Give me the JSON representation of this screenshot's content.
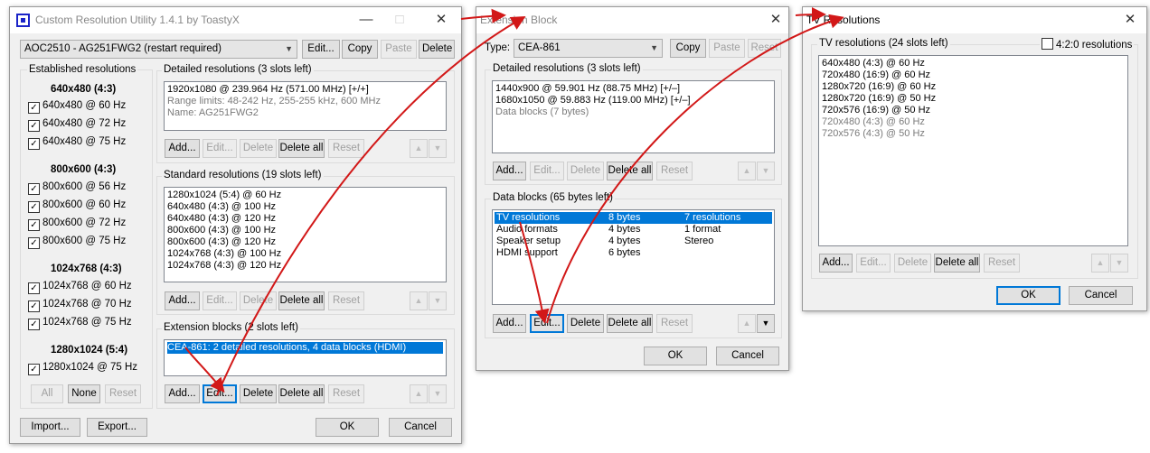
{
  "win1": {
    "title": "Custom Resolution Utility 1.4.1 by ToastyX",
    "monitor": "AOC2510 - AG251FWG2 (restart required)",
    "top_buttons": [
      "Edit...",
      "Copy",
      "Paste",
      "Delete"
    ],
    "established": {
      "label": "Established resolutions",
      "groups": [
        {
          "heading": "640x480 (4:3)",
          "items": [
            "640x480 @ 60 Hz",
            "640x480 @ 72 Hz",
            "640x480 @ 75 Hz"
          ]
        },
        {
          "heading": "800x600 (4:3)",
          "items": [
            "800x600 @ 56 Hz",
            "800x600 @ 60 Hz",
            "800x600 @ 72 Hz",
            "800x600 @ 75 Hz"
          ]
        },
        {
          "heading": "1024x768 (4:3)",
          "items": [
            "1024x768 @ 60 Hz",
            "1024x768 @ 70 Hz",
            "1024x768 @ 75 Hz"
          ]
        },
        {
          "heading": "1280x1024 (5:4)",
          "items": [
            "1280x1024 @ 75 Hz"
          ]
        }
      ],
      "buttons": [
        "All",
        "None",
        "Reset"
      ]
    },
    "detailed": {
      "label": "Detailed resolutions (3 slots left)",
      "line1": "1920x1080 @ 239.964 Hz (571.00 MHz) [+/+]",
      "line2": "Range limits: 48-242 Hz, 255-255 kHz, 600 MHz",
      "line3": "Name: AG251FWG2"
    },
    "standard": {
      "label": "Standard resolutions (19 slots left)",
      "items": [
        "1280x1024 (5:4) @ 60 Hz",
        "640x480 (4:3) @ 100 Hz",
        "640x480 (4:3) @ 120 Hz",
        "800x600 (4:3) @ 100 Hz",
        "800x600 (4:3) @ 120 Hz",
        "1024x768 (4:3) @ 100 Hz",
        "1024x768 (4:3) @ 120 Hz"
      ]
    },
    "extension": {
      "label": "Extension blocks (2 slots left)",
      "item": "CEA-861: 2 detailed resolutions, 4 data blocks (HDMI)"
    },
    "list_buttons": [
      "Add...",
      "Edit...",
      "Delete",
      "Delete all",
      "Reset"
    ],
    "bottom": [
      "Import...",
      "Export...",
      "OK",
      "Cancel"
    ]
  },
  "win2": {
    "title": "Extension Block",
    "type_label": "Type:",
    "type_value": "CEA-861",
    "top_buttons": [
      "Copy",
      "Paste",
      "Reset"
    ],
    "detailed": {
      "label": "Detailed resolutions (3 slots left)",
      "line1": "1440x900 @ 59.901 Hz (88.75 MHz) [+/–]",
      "line2": "1680x1050 @ 59.883 Hz (119.00 MHz) [+/–]",
      "line3": "Data blocks (7 bytes)"
    },
    "data_blocks": {
      "label": "Data blocks (65 bytes left)",
      "rows": [
        {
          "name": "TV resolutions",
          "size": "8 bytes",
          "info": "7 resolutions"
        },
        {
          "name": "Audio formats",
          "size": "4 bytes",
          "info": "1 format"
        },
        {
          "name": "Speaker setup",
          "size": "4 bytes",
          "info": "Stereo"
        },
        {
          "name": "HDMI support",
          "size": "6 bytes",
          "info": ""
        }
      ]
    },
    "list_buttons": [
      "Add...",
      "Edit...",
      "Delete",
      "Delete all",
      "Reset"
    ],
    "bottom": [
      "OK",
      "Cancel"
    ]
  },
  "win3": {
    "title": "TV Resolutions",
    "label": "TV resolutions (24 slots left)",
    "checkbox": "4:2:0 resolutions",
    "items": [
      "640x480 (4:3) @ 60 Hz",
      "720x480 (16:9) @ 60 Hz",
      "1280x720 (16:9) @ 60 Hz",
      "1280x720 (16:9) @ 50 Hz",
      "720x576 (16:9) @ 50 Hz"
    ],
    "gray_items": [
      "720x480 (4:3) @ 60 Hz",
      "720x576 (4:3) @ 50 Hz"
    ],
    "list_buttons": [
      "Add...",
      "Edit...",
      "Delete",
      "Delete all",
      "Reset"
    ],
    "bottom": [
      "OK",
      "Cancel"
    ]
  },
  "colors": {
    "selection": "#0078d7",
    "arrow": "#d21818",
    "window_bg": "#f0f0f0"
  }
}
